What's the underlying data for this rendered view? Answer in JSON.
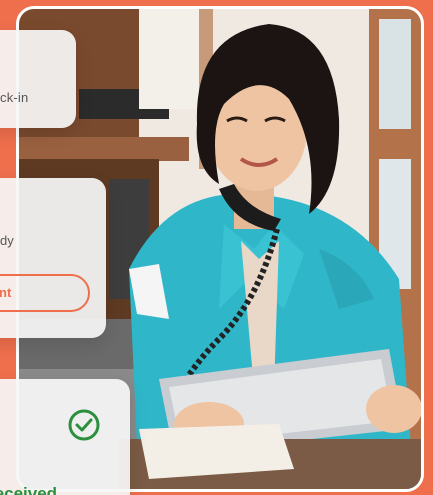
{
  "cards": {
    "checkin_text": "ck-in",
    "ready_text": "dy",
    "ready_button_label": "nt",
    "received_text": "t Received"
  },
  "colors": {
    "accent": "#ef6f4d",
    "success": "#2c8f3e",
    "card_bg": "#f6f6f6"
  },
  "icons": {
    "received_status": "check-circle-icon"
  }
}
